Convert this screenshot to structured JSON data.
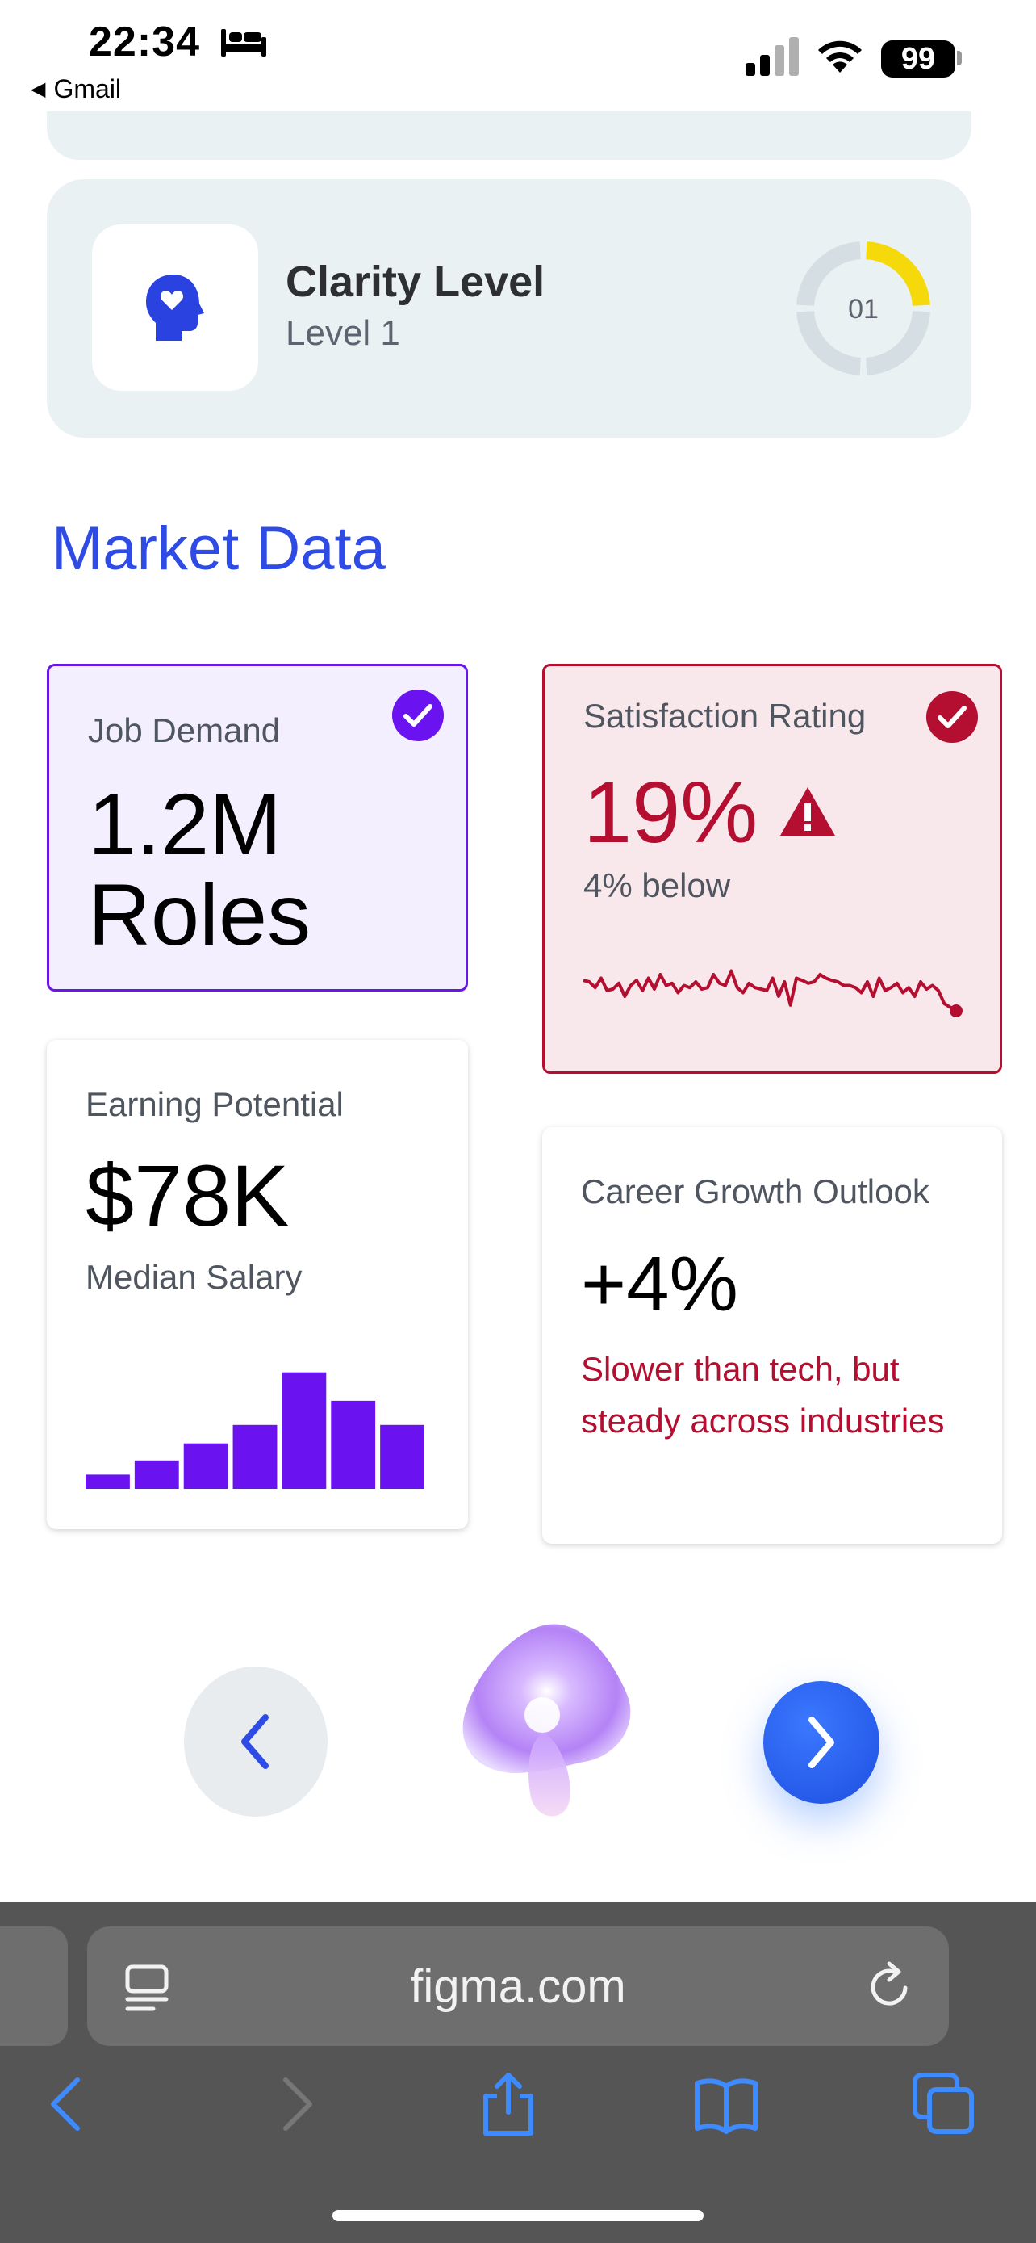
{
  "status_bar": {
    "time": "22:34",
    "back_label": "Gmail",
    "battery": "99"
  },
  "clarity": {
    "title": "Clarity Level",
    "level": "Level 1",
    "ring_label": "01",
    "ring_progress": 0.25,
    "ring_color": "#f5d90a",
    "ring_track_color": "#d5dfe3",
    "icon": "head-heart-icon"
  },
  "section": {
    "title": "Market Data"
  },
  "cards": {
    "job_demand": {
      "label": "Job Demand",
      "value": "1.2M Roles"
    },
    "satisfaction": {
      "label": "Satisfaction Rating",
      "value": "19%",
      "sub": "4% below"
    },
    "earning": {
      "label": "Earning Potential",
      "value": "$78K",
      "sub": "Median Salary"
    },
    "growth": {
      "label": "Career Growth Outlook",
      "value": "+4%",
      "note": "Slower than tech, but steady across industries"
    }
  },
  "chart_data": [
    {
      "type": "bar",
      "values": [
        10,
        20,
        32,
        45,
        82,
        62,
        45
      ],
      "ylim": [
        0,
        100
      ],
      "color": "#6a12f0"
    },
    {
      "type": "line",
      "values": [
        52,
        50,
        42,
        55,
        38,
        40,
        48,
        30,
        45,
        52,
        38,
        55,
        40,
        60,
        45,
        48,
        35,
        45,
        42,
        50,
        40,
        42,
        60,
        48,
        45,
        65,
        42,
        35,
        48,
        42,
        40,
        38,
        55,
        30,
        50,
        18,
        55,
        52,
        48,
        50,
        60,
        55,
        52,
        50,
        45,
        45,
        42,
        35,
        50,
        30,
        55,
        38,
        42,
        48,
        35,
        42,
        30,
        50,
        40,
        45,
        38,
        20,
        15,
        10
      ],
      "ylim": [
        0,
        100
      ],
      "color": "#b40e30"
    }
  ],
  "browser": {
    "url": "figma.com"
  },
  "colors": {
    "brand_blue": "#2f4be6",
    "purple": "#6a16e8",
    "red": "#b40e30"
  }
}
